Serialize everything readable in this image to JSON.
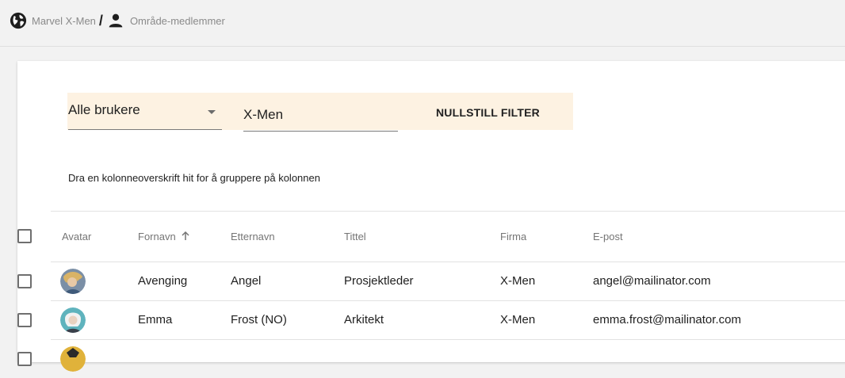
{
  "breadcrumb": {
    "project": "Marvel X-Men",
    "separator": "/",
    "page": "Område-medlemmer",
    "project_icon": "globe-icon",
    "page_icon": "person-icon"
  },
  "filters": {
    "user_select_value": "Alle brukere",
    "group_input_value": "X-Men",
    "reset_label": "NULLSTILL FILTER"
  },
  "grid": {
    "group_hint": "Dra en kolonneoverskrift hit for å gruppere på kolonnen",
    "columns": {
      "avatar": "Avatar",
      "firstname": "Fornavn",
      "lastname": "Etternavn",
      "title": "Tittel",
      "company": "Firma",
      "email": "E-post"
    },
    "sort": {
      "column": "Fornavn",
      "direction": "ascending",
      "icon": "arrow-up-icon"
    },
    "rows": [
      {
        "firstname": "Avenging",
        "lastname": "Angel",
        "title": "Prosjektleder",
        "company": "X-Men",
        "email": "angel@mailinator.com",
        "avatar_color": "#c9a15a"
      },
      {
        "firstname": "Emma",
        "lastname": "Frost (NO)",
        "title": "Arkitekt",
        "company": "X-Men",
        "email": "emma.frost@mailinator.com",
        "avatar_color": "#6fc0c8"
      },
      {
        "firstname": "",
        "lastname": "",
        "title": "",
        "company": "",
        "email": "",
        "avatar_color": "#e0b23a"
      }
    ]
  },
  "colors": {
    "filter_bar_bg": "#fdf2e2",
    "page_bg": "#f2f2f2",
    "card_bg": "#ffffff"
  }
}
